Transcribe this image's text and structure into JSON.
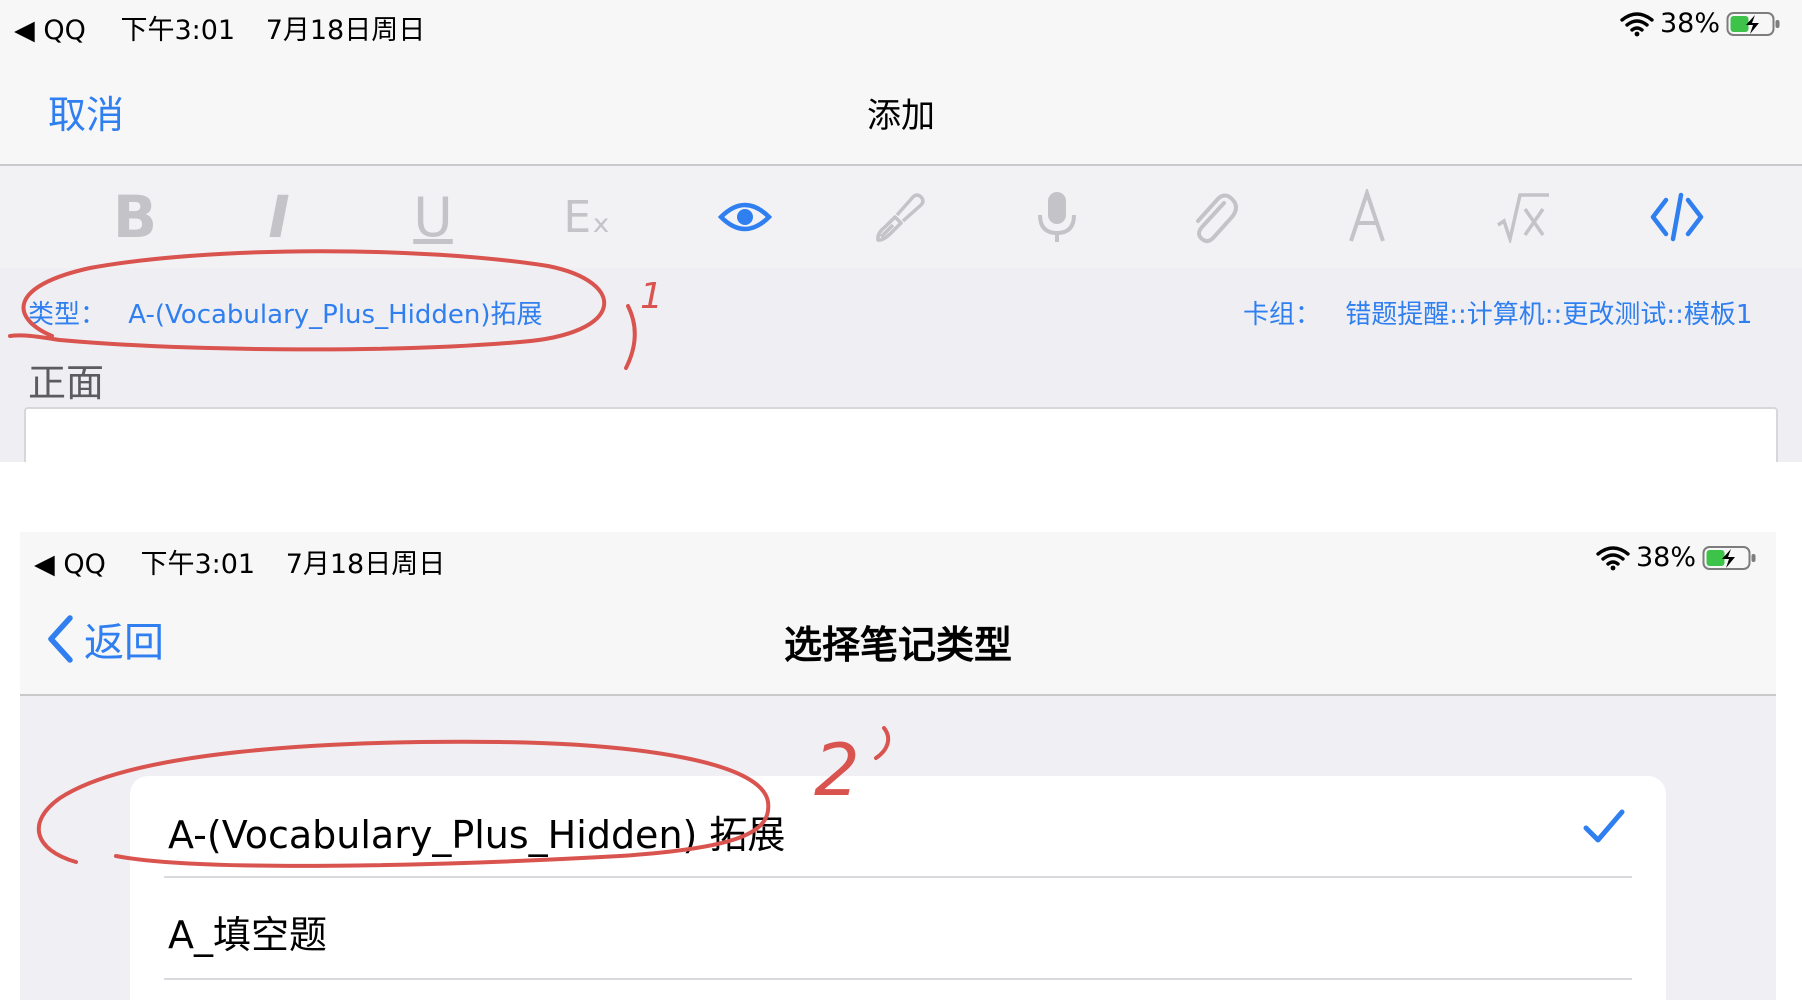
{
  "panel1": {
    "status_bar": {
      "back_app": "QQ",
      "time": "下午3:01",
      "date": "7月18日周日",
      "battery": "38%"
    },
    "nav": {
      "cancel_label": "取消",
      "title": "添加"
    },
    "toolbar": {
      "items": [
        {
          "name": "bold-icon",
          "glyph": "B",
          "active": false
        },
        {
          "name": "italic-icon",
          "glyph": "I",
          "active": false
        },
        {
          "name": "underline-icon",
          "glyph": "U",
          "active": false
        },
        {
          "name": "clear-format-icon",
          "glyph": "Eₓ",
          "active": false
        },
        {
          "name": "eye-icon",
          "active": true
        },
        {
          "name": "paintbrush-icon",
          "active": false
        },
        {
          "name": "microphone-icon",
          "active": false
        },
        {
          "name": "paperclip-icon",
          "active": false
        },
        {
          "name": "font-icon",
          "active": false
        },
        {
          "name": "math-icon",
          "active": false
        },
        {
          "name": "code-icon",
          "active": true
        }
      ]
    },
    "meta": {
      "type_label": "类型：",
      "type_value": "A-(Vocabulary_Plus_Hidden)拓展",
      "deck_label": "卡组：",
      "deck_value": "错题提醒::计算机::更改测试::模板1"
    },
    "field_label": "正面",
    "annotation": "1"
  },
  "panel2": {
    "status_bar": {
      "back_app": "QQ",
      "time": "下午3:01",
      "date": "7月18日周日",
      "battery": "38%"
    },
    "nav": {
      "back_label": "返回",
      "title": "选择笔记类型"
    },
    "list": [
      {
        "label": "A-(Vocabulary_Plus_Hidden) 拓展",
        "selected": true
      },
      {
        "label": "A_填空题",
        "selected": false
      }
    ],
    "annotation": "2"
  },
  "colors": {
    "accent": "#2f7ff0",
    "annotation": "#d9534f",
    "toolbar_inactive": "#c4c4c8"
  }
}
